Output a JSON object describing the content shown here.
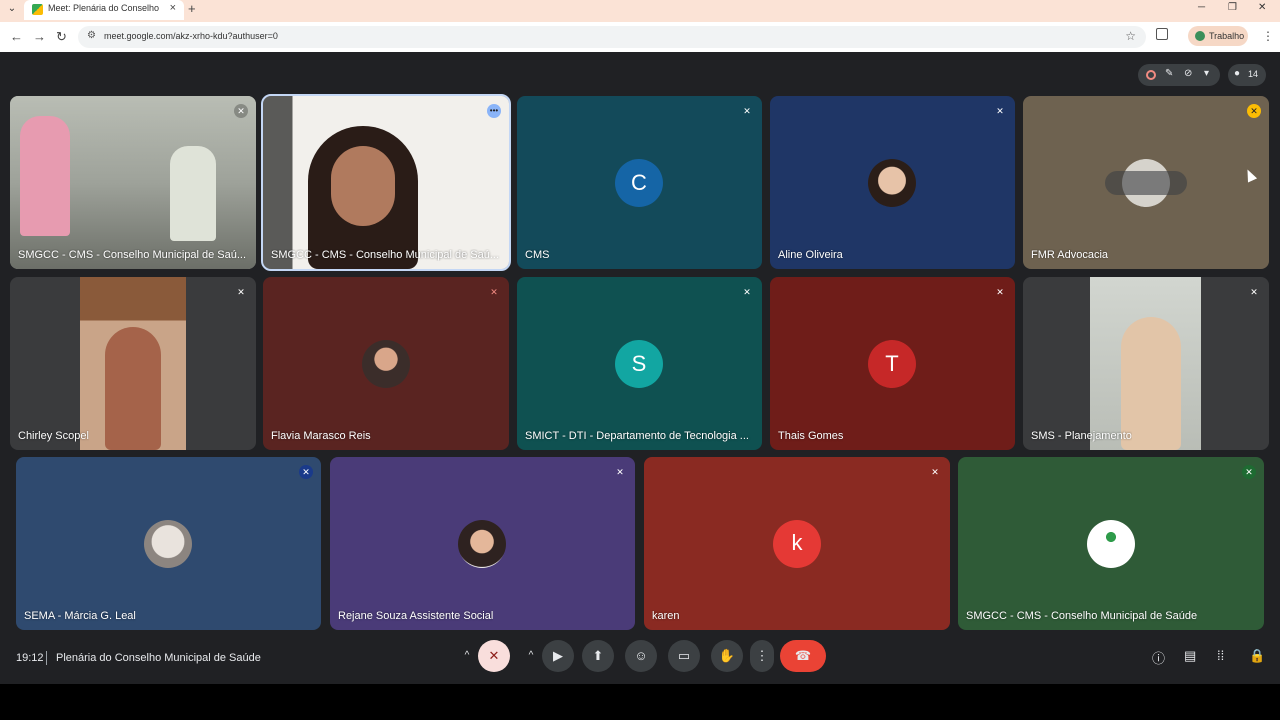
{
  "browser": {
    "tab_title": "Meet: Plenária do Conselho",
    "new_tab": "+",
    "url": "meet.google.com/akz-xrho-kdu?authuser=0",
    "profile_label": "Trabalho",
    "win_minimize": "─",
    "win_restore": "❐",
    "win_close": "✕"
  },
  "meet": {
    "participant_count": "14",
    "clock": "19:12",
    "meeting_title": "Plenária do Conselho Municipal de Saúde",
    "tiles": [
      {
        "name": "SMGCC - CMS - Conselho Municipal de Saú...",
        "type": "video",
        "color": "#8a8f85"
      },
      {
        "name": "SMGCC - CMS - Conselho Municipal de Saú...",
        "type": "video",
        "color": "#e9e6e2"
      },
      {
        "name": "CMS",
        "type": "letter",
        "letter": "C",
        "bg": "#134a5a",
        "avatar": "#1565a6"
      },
      {
        "name": "Aline Oliveira",
        "type": "photo",
        "bg": "#1f3666"
      },
      {
        "name": "FMR Advocacia",
        "type": "photo",
        "bg": "#6e6250"
      },
      {
        "name": "Chirley Scopel",
        "type": "video",
        "bg": "#3a3b3d"
      },
      {
        "name": "Flavia Marasco Reis",
        "type": "photo",
        "bg": "#5a2421"
      },
      {
        "name": "SMICT - DTI - Departamento de Tecnologia ...",
        "type": "letter",
        "letter": "S",
        "bg": "#0f5151",
        "avatar": "#12a6a2"
      },
      {
        "name": "Thais Gomes",
        "type": "letter",
        "letter": "T",
        "bg": "#6f1d19",
        "avatar": "#c62828"
      },
      {
        "name": "SMS - Planejamento",
        "type": "video",
        "bg": "#3a3b3d"
      },
      {
        "name": "SEMA - Márcia G. Leal",
        "type": "photo",
        "bg": "#2f4a6f"
      },
      {
        "name": "Rejane Souza Assistente Social",
        "type": "photo",
        "bg": "#4a3b78"
      },
      {
        "name": "karen",
        "type": "letter",
        "letter": "k",
        "bg": "#8a2a22",
        "avatar": "#e53935"
      },
      {
        "name": "SMGCC - CMS - Conselho Municipal de Saúde",
        "type": "photo",
        "bg": "#2f5b37"
      }
    ]
  }
}
